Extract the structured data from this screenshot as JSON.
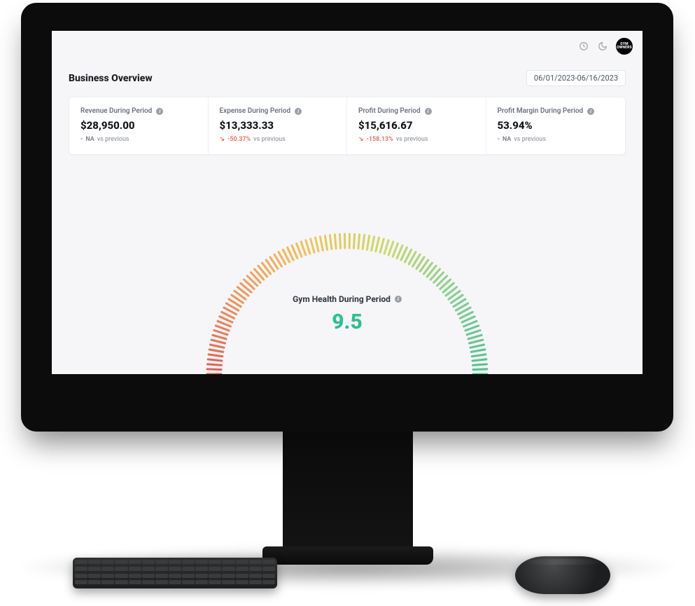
{
  "header": {
    "page_title": "Business Overview",
    "date_range": "06/01/2023-06/16/2023",
    "avatar_text": "GYM OWNERS"
  },
  "kpi": [
    {
      "label": "Revenue During Period",
      "value": "$28,950.00",
      "delta_prefix": "-",
      "delta_value": "NA",
      "delta_suffix": "vs previous",
      "tone": "muted",
      "icon_name": "info-icon"
    },
    {
      "label": "Expense During Period",
      "value": "$13,333.33",
      "delta_prefix": "↘",
      "delta_value": "-50.37%",
      "delta_suffix": "vs previous",
      "tone": "red",
      "icon_name": "info-icon"
    },
    {
      "label": "Profit During Period",
      "value": "$15,616.67",
      "delta_prefix": "↘",
      "delta_value": "-158.13%",
      "delta_suffix": "vs previous",
      "tone": "red",
      "icon_name": "info-icon"
    },
    {
      "label": "Profit Margin During Period",
      "value": "53.94%",
      "delta_prefix": "-",
      "delta_value": "NA",
      "delta_suffix": "vs previous",
      "tone": "muted",
      "icon_name": "info-icon"
    }
  ],
  "gauge": {
    "title": "Gym Health During Period",
    "score": "9.5"
  },
  "chart_data": {
    "type": "gauge",
    "title": "Gym Health During Period",
    "value": 9.5,
    "min": 0,
    "max": 10,
    "color_scale": [
      "#e55a4f",
      "#f0955a",
      "#f0c35a",
      "#c9d96a",
      "#7fd08e",
      "#4fc08e"
    ]
  }
}
